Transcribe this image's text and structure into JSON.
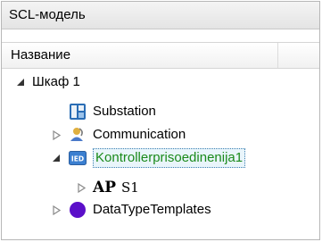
{
  "window": {
    "title": "SCL-модель"
  },
  "header": {
    "column_name": "Название"
  },
  "tree": {
    "root": {
      "label": "Шкаф 1"
    },
    "substation": {
      "label": "Substation"
    },
    "communication": {
      "label": "Communication"
    },
    "ied": {
      "label": "Kontrollerprisoedinenija1",
      "icon_text": "IED"
    },
    "ap": {
      "label": "S1",
      "icon_text": "AP"
    },
    "datatypes": {
      "label": "DataTypeTemplates"
    }
  },
  "colors": {
    "selection_text": "#1a8a1a",
    "datatype_icon": "#5b0fc9",
    "substation_icon": "#2a6db5"
  }
}
